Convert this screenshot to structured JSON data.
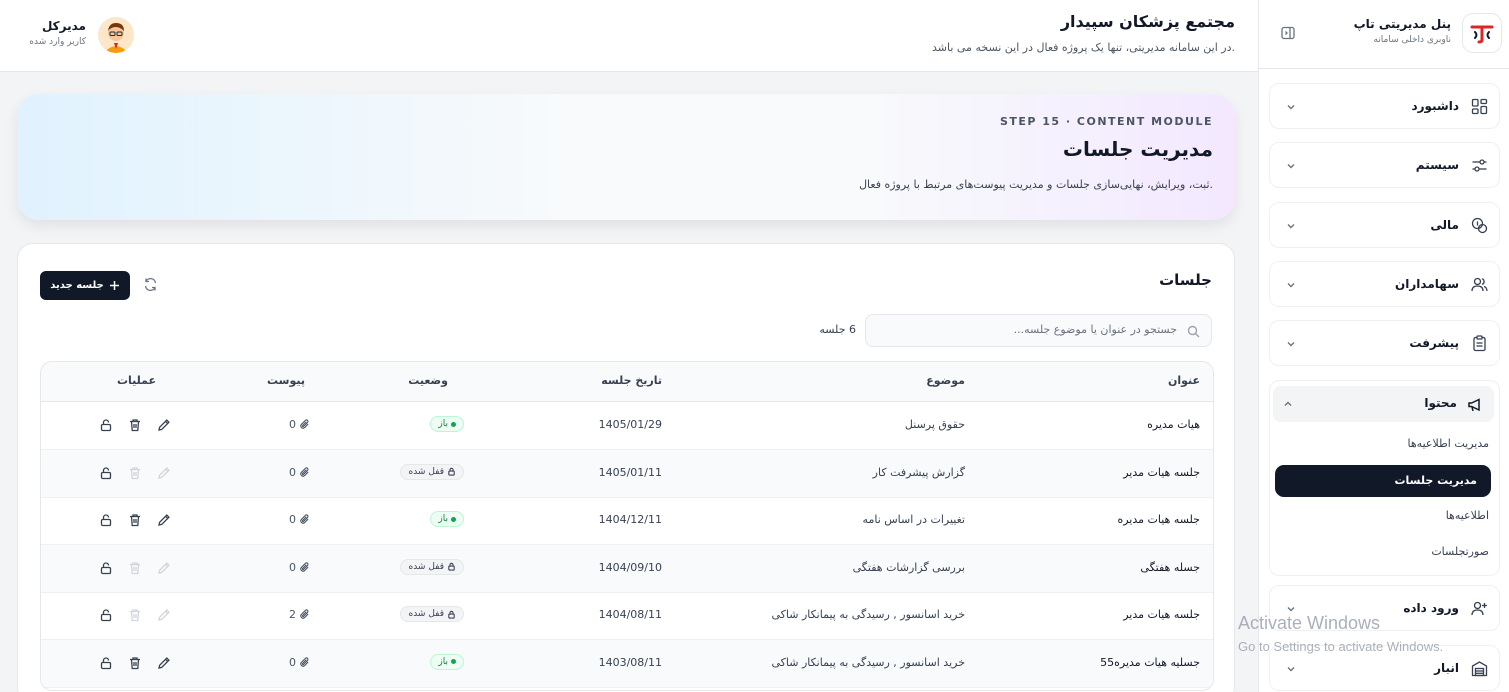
{
  "brand": {
    "title": "پنل مدیریتی تاپ",
    "subtitle": "ناوبری داخلی سامانه",
    "logo_icon": "brand-logo-icon"
  },
  "header": {
    "title": "مجتمع پزشکان سپیدار",
    "subtitle": "در این سامانه مدیریتی، تنها یک پروژه فعال در این نسخه می باشد.",
    "user_name": "مدیرکل",
    "user_role": "کاربر وارد شده"
  },
  "sidebar": {
    "items": [
      {
        "label": "داشبورد",
        "icon": "dashboard-icon"
      },
      {
        "label": "سیستم",
        "icon": "sliders-icon"
      },
      {
        "label": "مالی",
        "icon": "coins-icon"
      },
      {
        "label": "سهامداران",
        "icon": "users-icon"
      },
      {
        "label": "پیشرفت",
        "icon": "clipboard-icon"
      },
      {
        "label": "محتوا",
        "icon": "megaphone-icon"
      },
      {
        "label": "ورود داده",
        "icon": "user-plus-icon"
      },
      {
        "label": "انبار",
        "icon": "warehouse-icon"
      }
    ],
    "content_sub": [
      {
        "label": "مدیریت اطلاعیه‌ها"
      },
      {
        "label": "مدیریت جلسات"
      },
      {
        "label": "اطلاعیه‌ها"
      },
      {
        "label": "صورتجلسات"
      }
    ]
  },
  "hero": {
    "step": "STEP 15 · CONTENT MODULE",
    "title": "مدیریت جلسات",
    "description": "ثبت، ویرایش، نهایی‌سازی جلسات و مدیریت پیوست‌های مرتبط با پروژه فعال."
  },
  "meetings": {
    "title": "جلسات",
    "new_button": "جلسه جدید",
    "search_placeholder": "جستجو در عنوان یا موضوع جلسه...",
    "count": "6 جلسه",
    "columns": {
      "title": "عنوان",
      "topic": "موضوع",
      "date": "تاریخ جلسه",
      "status": "وضعیت",
      "attachment": "پیوست",
      "operations": "عملیات"
    },
    "rows": [
      {
        "title": "هیات مدیره",
        "topic": "حقوق پرسنل",
        "date": "1405/01/29",
        "status": "باز",
        "attachments": "0"
      },
      {
        "title": "جلسه هیات مدیر",
        "topic": "گزارش پیشرفت کار",
        "date": "1405/01/11",
        "status": "قفل شده",
        "attachments": "0"
      },
      {
        "title": "جلسه هیات مدیره",
        "topic": "تغییرات در اساس نامه",
        "date": "1404/12/11",
        "status": "باز",
        "attachments": "0"
      },
      {
        "title": "جسله هفتگی",
        "topic": "بررسی گزارشات هفتگی",
        "date": "1404/09/10",
        "status": "قفل شده",
        "attachments": "0"
      },
      {
        "title": "جلسه هیات مدیر",
        "topic": "خرید اسانسور , رسیدگی به پیمانکار شاکی",
        "date": "1404/08/11",
        "status": "قفل شده",
        "attachments": "2"
      },
      {
        "title": "جسلیه هیات مدیره55",
        "topic": "خرید اسانسور , رسیدگی به پیمانکار شاکی",
        "date": "1403/08/11",
        "status": "باز",
        "attachments": "0"
      }
    ]
  },
  "watermark": {
    "line1": "Activate Windows",
    "line2": "Go to Settings to activate Windows."
  },
  "colors": {
    "primary": "#111827",
    "open_green": "#16a34a",
    "border": "#e5e7eb"
  }
}
